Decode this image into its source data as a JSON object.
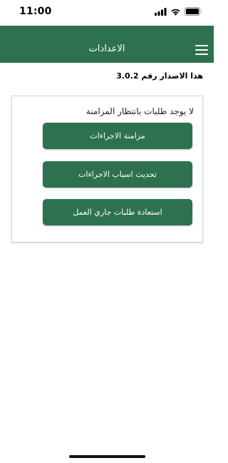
{
  "status_bar": {
    "time": "11:00",
    "signal_icon": "signal-bars-icon",
    "wifi_icon": "wifi-icon",
    "battery_icon": "battery-icon"
  },
  "header": {
    "title": "الاعدادات",
    "menu_icon": "hamburger-menu-icon"
  },
  "version_text": "هذا الاصدار رقم 3.0.2",
  "card": {
    "pending_text": "لا يوجد طلبات بانتظار المزامنة",
    "buttons": [
      {
        "label": "مزامنة الاجراءات"
      },
      {
        "label": "تحديث اسباب الاجراءات"
      },
      {
        "label": "استعادة طلبات جاري العمل"
      }
    ]
  },
  "colors": {
    "primary": "#2e7150",
    "background": "#ffffff",
    "text": "#000000"
  }
}
